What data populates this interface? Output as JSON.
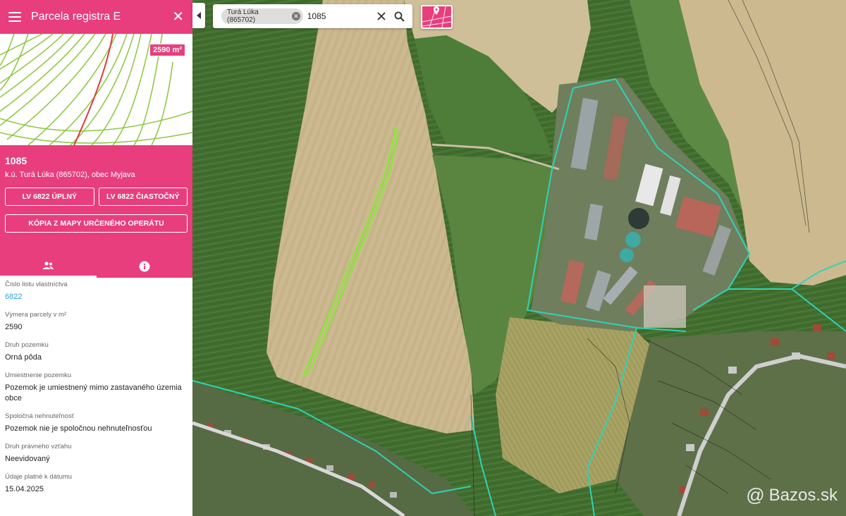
{
  "panel": {
    "title": "Parcela registra E",
    "area_badge": "2590 m²",
    "parcel_number": "1085",
    "location": "k.ú. Turá Lúka (865702), obec Myjava",
    "buttons": {
      "lv_full": "LV 6822 ÚPLNÝ",
      "lv_partial": "LV 6822 ČIASTOČNÝ",
      "copy_map": "KÓPIA Z MAPY URČENÉHO OPERÁTU"
    },
    "tabs": [
      {
        "icon": "owners-icon"
      },
      {
        "icon": "info-icon"
      }
    ],
    "fields": [
      {
        "label": "Číslo listu vlastníctva",
        "value": "6822",
        "link": true
      },
      {
        "label": "Výmera parcely v m²",
        "value": "2590"
      },
      {
        "label": "Druh pozemku",
        "value": "Orná pôda"
      },
      {
        "label": "Umiestnenie pozemku",
        "value": "Pozemok je umiestnený mimo zastavaného územia obce"
      },
      {
        "label": "Spoločná nehnuteľnosť",
        "value": "Pozemok nie je spoločnou nehnuteľnosťou"
      },
      {
        "label": "Druh právneho vzťahu",
        "value": "Neevidovaný"
      },
      {
        "label": "Údaje platné k dátumu",
        "value": "15.04.2025"
      }
    ]
  },
  "search": {
    "chip_label": "Turá Lúka (865702)",
    "query": "1085"
  },
  "watermark": {
    "at": "@",
    "text": "Bazos.sk"
  },
  "colors": {
    "accent": "#e83e7d",
    "parcel_outline": "#8ce63c",
    "boundary": "#2fd3b5",
    "link": "#2e9fd6"
  }
}
